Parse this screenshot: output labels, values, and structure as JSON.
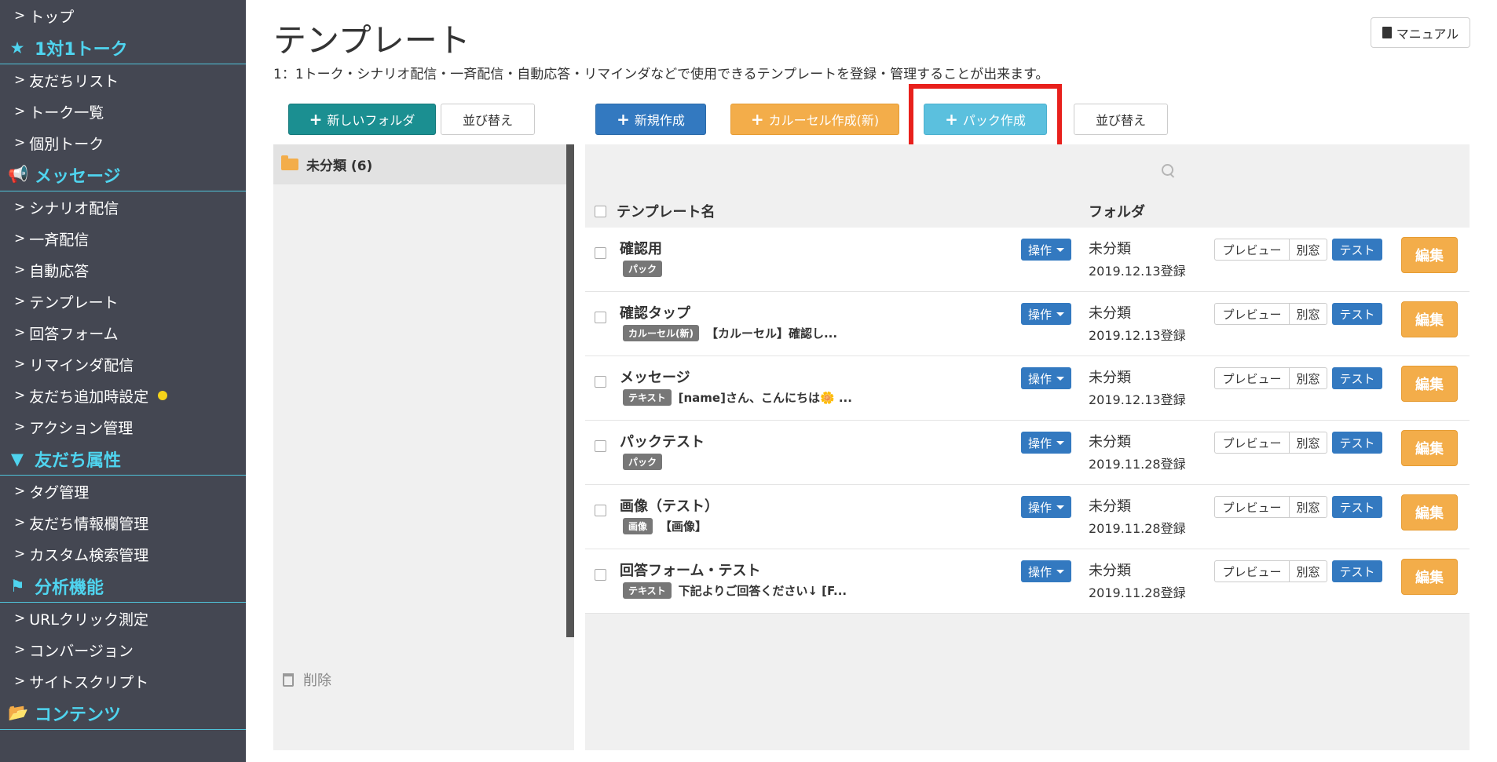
{
  "sidebar": {
    "items": [
      {
        "type": "item",
        "label": "トップ"
      },
      {
        "type": "section",
        "label": "1対1トーク",
        "icon": "star-icon"
      },
      {
        "type": "item",
        "label": "友だちリスト"
      },
      {
        "type": "item",
        "label": "トーク一覧"
      },
      {
        "type": "item",
        "label": "個別トーク"
      },
      {
        "type": "section",
        "label": "メッセージ",
        "icon": "megaphone-icon"
      },
      {
        "type": "item",
        "label": "シナリオ配信"
      },
      {
        "type": "item",
        "label": "一斉配信"
      },
      {
        "type": "item",
        "label": "自動応答"
      },
      {
        "type": "item",
        "label": "テンプレート"
      },
      {
        "type": "item",
        "label": "回答フォーム"
      },
      {
        "type": "item",
        "label": "リマインダ配信"
      },
      {
        "type": "item",
        "label": "友だち追加時設定",
        "badge": "dot"
      },
      {
        "type": "item",
        "label": "アクション管理"
      },
      {
        "type": "section",
        "label": "友だち属性",
        "icon": "filter-icon"
      },
      {
        "type": "item",
        "label": "タグ管理"
      },
      {
        "type": "item",
        "label": "友だち情報欄管理"
      },
      {
        "type": "item",
        "label": "カスタム検索管理"
      },
      {
        "type": "section",
        "label": "分析機能",
        "icon": "flag-icon"
      },
      {
        "type": "item",
        "label": "URLクリック測定"
      },
      {
        "type": "item",
        "label": "コンバージョン"
      },
      {
        "type": "item",
        "label": "サイトスクリプト"
      },
      {
        "type": "section",
        "label": "コンテンツ",
        "icon": "folder-open-icon"
      }
    ]
  },
  "header": {
    "title": "テンプレート",
    "manual_label": "マニュアル",
    "subtitle": "1：1トーク・シナリオ配信・一斉配信・自動応答・リマインダなどで使用できるテンプレートを登録・管理することが出来ます。"
  },
  "toolbar": {
    "new_folder": "新しいフォルダ",
    "sort_folders": "並び替え",
    "new_create": "新規作成",
    "carousel_create": "カルーセル作成(新)",
    "pack_create": "パック作成",
    "sort_templates": "並び替え"
  },
  "folders": {
    "selected": "未分類 (6)",
    "delete_label": "削除"
  },
  "table": {
    "col_name": "テンプレート名",
    "col_folder": "フォルダ",
    "op_label": "操作",
    "preview_label": "プレビュー",
    "window_label": "別窓",
    "test_label": "テスト",
    "edit_label": "編集",
    "rows": [
      {
        "name": "確認用",
        "tag": "パック",
        "desc": "",
        "folder": "未分類",
        "date": "2019.12.13登録"
      },
      {
        "name": "確認タップ",
        "tag": "カルーセル(新)",
        "desc": "【カルーセル】確認し...",
        "folder": "未分類",
        "date": "2019.12.13登録"
      },
      {
        "name": "メッセージ",
        "tag": "テキスト",
        "desc": "[name]さん、こんにちは🌼 ...",
        "folder": "未分類",
        "date": "2019.12.13登録"
      },
      {
        "name": "パックテスト",
        "tag": "パック",
        "desc": "",
        "folder": "未分類",
        "date": "2019.11.28登録"
      },
      {
        "name": "画像（テスト）",
        "tag": "画像",
        "desc": "【画像】",
        "folder": "未分類",
        "date": "2019.11.28登録"
      },
      {
        "name": "回答フォーム・テスト",
        "tag": "テキスト",
        "desc": "下記よりご回答ください↓ [F...",
        "folder": "未分類",
        "date": "2019.11.28登録"
      }
    ]
  },
  "colors": {
    "sidebar_bg": "#444752",
    "sidebar_accent": "#4fd4ef",
    "teal": "#1b8f91",
    "blue": "#3379c0",
    "orange": "#f3ad4a",
    "cyan": "#5bc0de",
    "highlight": "#e8201c"
  }
}
